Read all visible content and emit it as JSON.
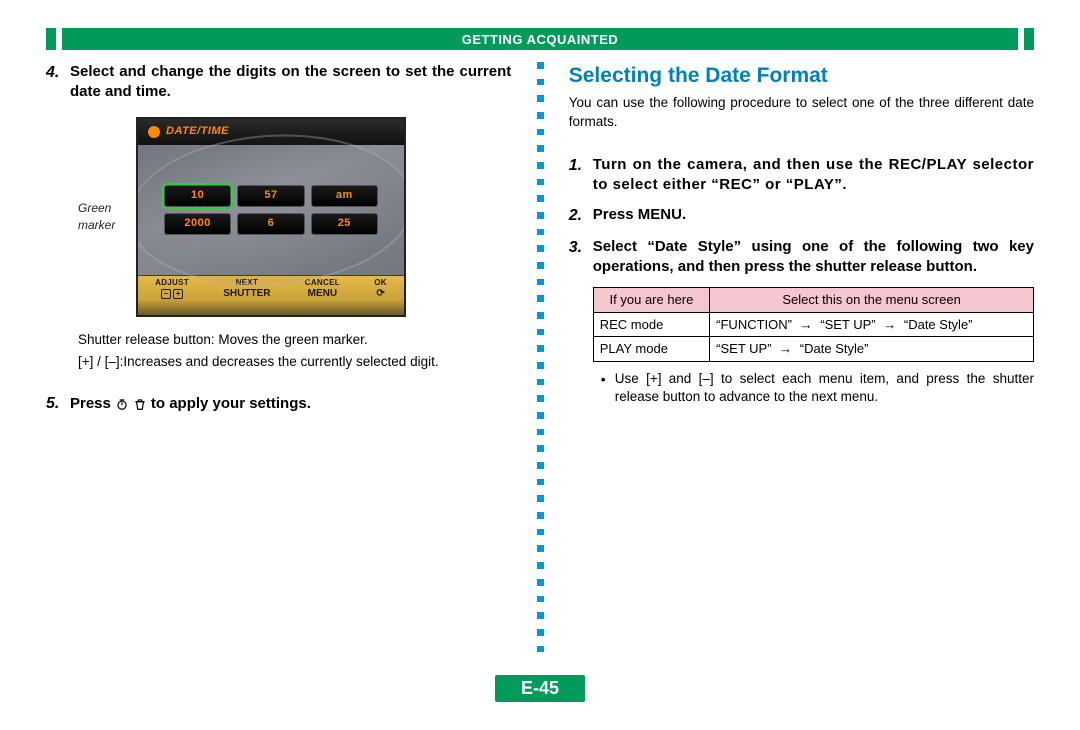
{
  "header": {
    "title": "GETTING ACQUAINTED"
  },
  "left": {
    "step4_num": "4.",
    "step4_text": "Select and change the digits on the screen to set the current date and time.",
    "annot_line1": "Green",
    "annot_line2": "marker",
    "lcd_title": "DATE/TIME",
    "row1": [
      "10",
      "57",
      "am"
    ],
    "row2": [
      "2000",
      "6",
      "25"
    ],
    "footer_labels": [
      "ADJUST",
      "NEXT",
      "CANCEL",
      "OK"
    ],
    "footer_icons": [
      "− +",
      "SHUTTER",
      "MENU",
      "⟳"
    ],
    "shutter_note": "Shutter release button: Moves the green marker.",
    "pm_key": "[+] / [–]: ",
    "pm_val": "Increases and decreases the currently selected digit.",
    "step5_num": "5.",
    "step5_a": "Press",
    "step5_b": "to apply your settings."
  },
  "right": {
    "heading": "Selecting the Date Format",
    "intro": "You can use the following procedure to select one of the three different date formats.",
    "s1_num": "1.",
    "s1_text": "Turn on the camera, and then use the REC/PLAY selector to select either “REC” or “PLAY”.",
    "s2_num": "2.",
    "s2_text": "Press MENU.",
    "s3_num": "3.",
    "s3_text": "Select “Date Style” using one of the following two key operations, and then press the shutter release button.",
    "th1": "If you are here",
    "th2": "Select this on the menu screen",
    "r1c1": "REC mode",
    "r1c2a": "“FUNCTION”",
    "r1c2b": "“SET UP”",
    "r1c2c": "“Date Style”",
    "r2c1": "PLAY mode",
    "r2c2a": "“SET UP”",
    "r2c2b": "“Date Style”",
    "bullet": "Use [+] and [–] to select each menu item, and press the shutter release button to advance to the next menu."
  },
  "page_num": "E-45"
}
